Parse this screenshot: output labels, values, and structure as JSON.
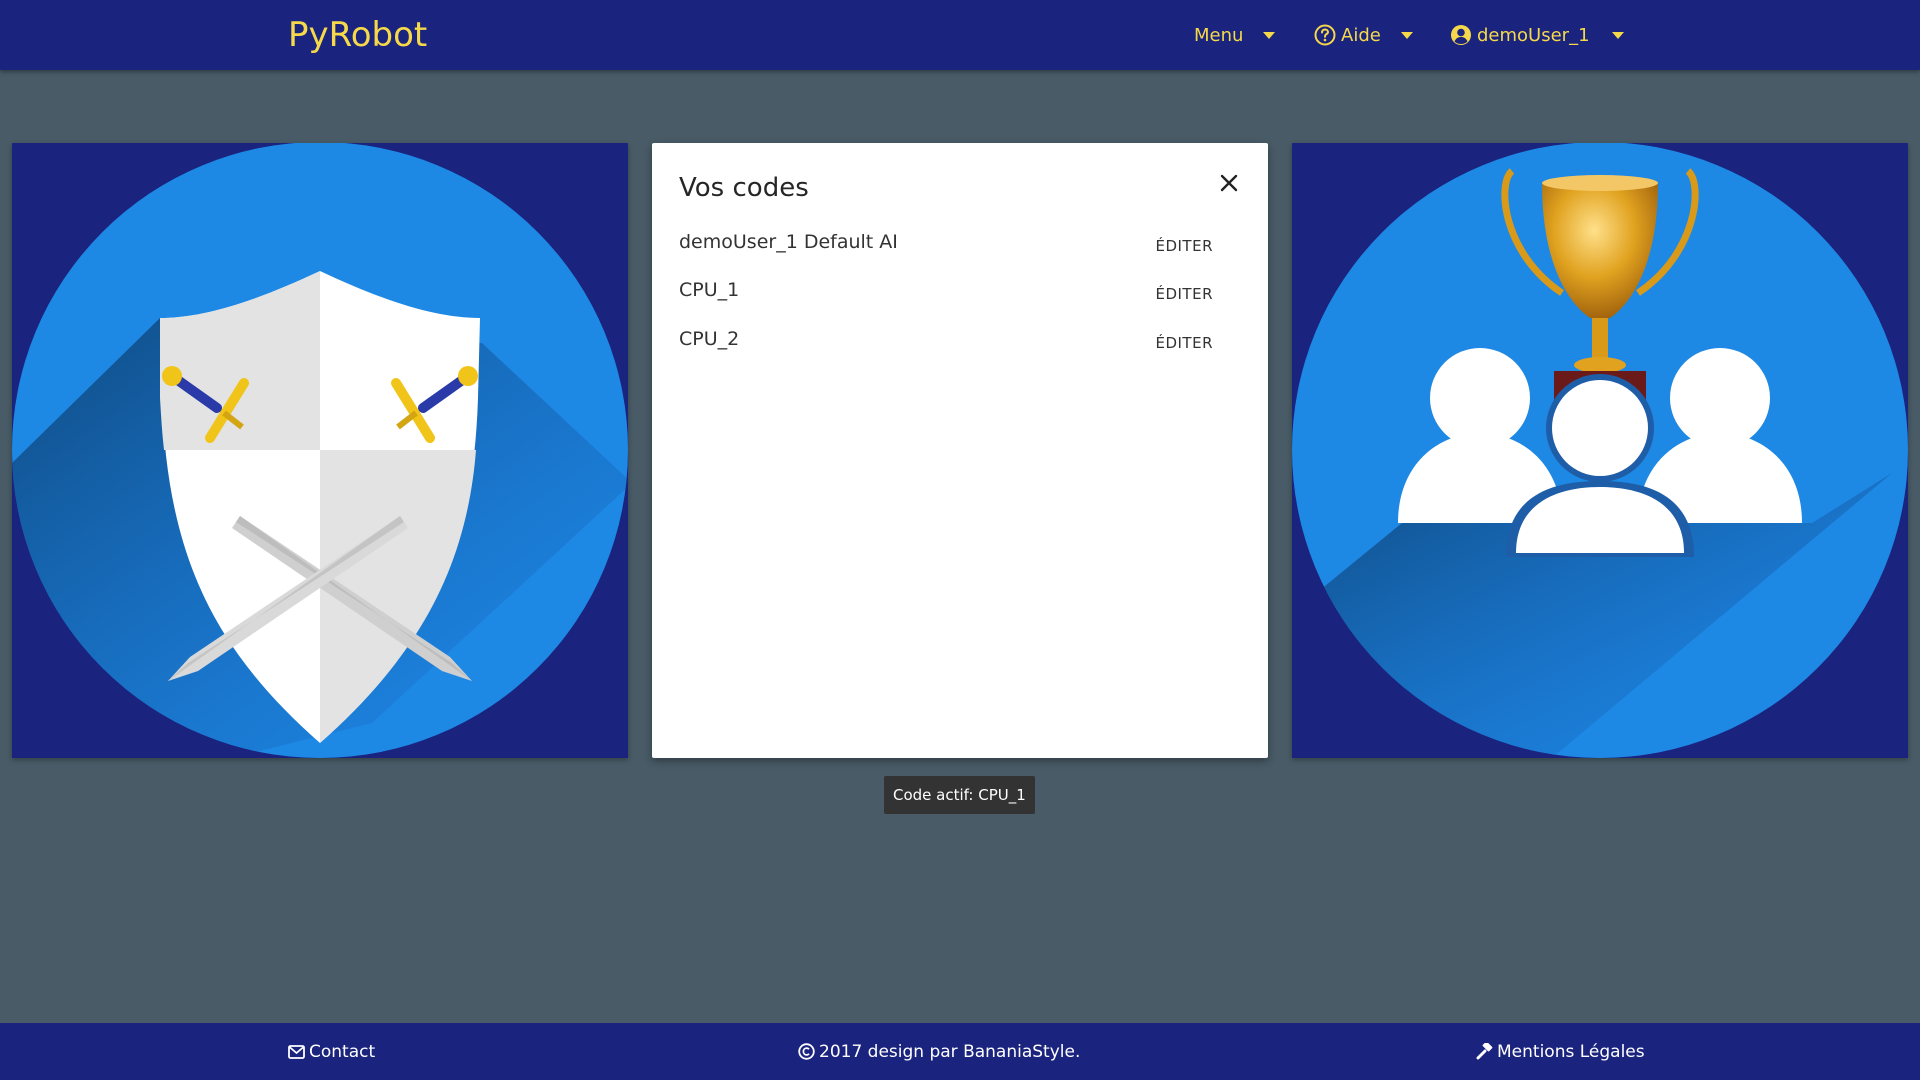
{
  "navbar": {
    "brand": "PyRobot",
    "menu_label": "Menu",
    "help_label": "Aide",
    "user_label": "demoUser_1"
  },
  "modal": {
    "title": "Vos codes",
    "codes": [
      {
        "name": "demoUser_1 Default AI",
        "action": "ÉDITER"
      },
      {
        "name": "CPU_1",
        "action": "ÉDITER"
      },
      {
        "name": "CPU_2",
        "action": "ÉDITER"
      }
    ]
  },
  "tooltip": {
    "text": "Code actif: CPU_1"
  },
  "footer": {
    "contact": "Contact",
    "copyright": "2017 design par BananiaStyle.",
    "legal": "Mentions Légales"
  },
  "icons": {
    "help": "question-circle-icon",
    "user": "user-circle-icon",
    "caret": "caret-down-icon",
    "close": "close-icon",
    "contact": "envelope-icon",
    "copyright": "copyright-icon",
    "legal": "gavel-icon",
    "left_tile": "shield-swords-icon",
    "right_tile": "trophy-users-icon"
  },
  "colors": {
    "navbar_bg": "#1a237e",
    "brand_yellow": "#f5d94a",
    "page_bg": "#485b66",
    "circle_blue": "#1e88e5",
    "tooltip_bg": "#333333"
  }
}
